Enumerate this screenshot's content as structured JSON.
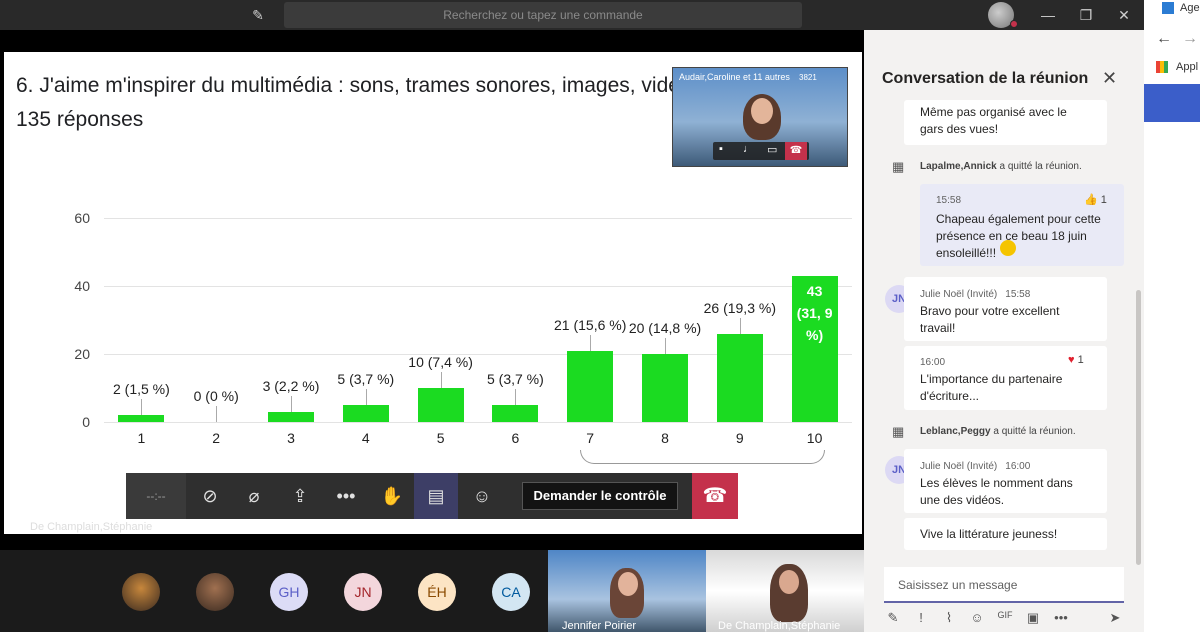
{
  "topbar": {
    "search_placeholder": "Recherchez ou tapez une commande"
  },
  "slide": {
    "title": "6. J'aime m'inspirer du multimédia : sons, trames sonores, images, vidé",
    "subtitle": "135 réponses"
  },
  "chart_data": {
    "type": "bar",
    "categories": [
      "1",
      "2",
      "3",
      "4",
      "5",
      "6",
      "7",
      "8",
      "9",
      "10"
    ],
    "values": [
      2,
      0,
      3,
      5,
      10,
      5,
      21,
      20,
      26,
      43
    ],
    "data_labels": [
      "2 (1,5 %)",
      "0 (0 %)",
      "3 (2,2 %)",
      "5 (3,7 %)",
      "10 (7,4 %)",
      "5 (3,7 %)",
      "21 (15,6 %)",
      "20 (14,8 %)",
      "26 (19,3 %)",
      "43 (31, 9 %)"
    ],
    "yticks": [
      "0",
      "20",
      "40",
      "60"
    ],
    "ylim": [
      0,
      60
    ],
    "bar_color": "#1bdb21",
    "grid": true,
    "title": "",
    "xlabel": "",
    "ylabel": ""
  },
  "selfview": {
    "label": "Audair,Caroline et 11 autres",
    "count": "3821"
  },
  "controls": {
    "timer": "--:--",
    "request_control": "Demander le contrôle",
    "icons": [
      "camera-off-icon",
      "mic-off-icon",
      "share-icon",
      "more-icon",
      "hand-icon",
      "chat-icon",
      "people-icon",
      "hangup-icon"
    ]
  },
  "presenter": "De Champlain,Stéphanie",
  "participants": [
    {
      "initials": "",
      "kind": "photo",
      "color": "#c7873c"
    },
    {
      "initials": "",
      "kind": "photo",
      "color": "#a07050"
    },
    {
      "initials": "GH",
      "color": "#dcdcf6",
      "text": "#5b5fc7"
    },
    {
      "initials": "JN",
      "color": "#f3d6dc",
      "text": "#a4262c"
    },
    {
      "initials": "ÉH",
      "color": "#fce4c4",
      "text": "#8a4a00"
    },
    {
      "initials": "CA",
      "color": "#d3e6f2",
      "text": "#005a9e"
    }
  ],
  "video_tiles": [
    {
      "name": "Jennifer Poirier"
    },
    {
      "name": "De Champlain,Stéphanie"
    }
  ],
  "chat": {
    "title": "Conversation de la réunion",
    "messages": {
      "m0": "Même pas organisé avec le gars des vues!",
      "sys1_name": "Lapalme,Annick",
      "sys1_text": " a quitté la réunion.",
      "m1_time": "15:58",
      "m1_react": "1",
      "m1_text": "Chapeau également pour cette présence en ce beau 18 juin ensoleillé!!!",
      "m2_author": "Julie Noël (Invité)",
      "m2_time": "15:58",
      "m2_text": "Bravo pour votre excellent travail!",
      "m3_time": "16:00",
      "m3_react": "1",
      "m3_text": "L'importance du partenaire d'écriture...",
      "sys2_name": "Leblanc,Peggy",
      "sys2_text": " a quitté la réunion.",
      "m4_author": "Julie Noël (Invité)",
      "m4_time": "16:00",
      "m4_text": "Les élèves le nomment dans une des vidéos.",
      "m5_text": "Vive la littérature jeuness!",
      "avatar_initials": "JN"
    },
    "compose_placeholder": "Saisissez un message"
  },
  "browser": {
    "tab_text": "Age",
    "bookmark_text": "Appl"
  }
}
